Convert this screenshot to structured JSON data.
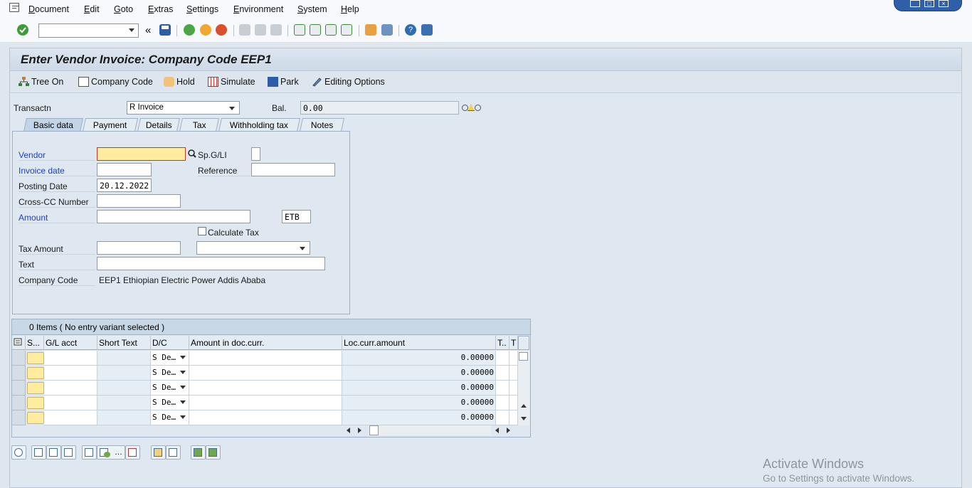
{
  "menu": [
    "Document",
    "Edit",
    "Goto",
    "Extras",
    "Settings",
    "Environment",
    "System",
    "Help"
  ],
  "toolbar": {
    "command_field_value": "",
    "back_symbol": "«"
  },
  "title": "Enter Vendor Invoice: Company Code EEP1",
  "app_toolbar": [
    "Tree On",
    "Company Code",
    "Hold",
    "Simulate",
    "Park",
    "Editing Options"
  ],
  "header": {
    "transaction_label": "Transactn",
    "transaction_value": "R Invoice",
    "balance_label": "Bal.",
    "balance_value": "0.00"
  },
  "tabs": [
    "Basic data",
    "Payment",
    "Details",
    "Tax",
    "Withholding tax",
    "Notes"
  ],
  "active_tab": "Basic data",
  "form": {
    "vendor_label": "Vendor",
    "vendor_value": "",
    "spgl_label": "Sp.G/LI",
    "invoice_date_label": "Invoice date",
    "invoice_date_value": "",
    "reference_label": "Reference",
    "reference_value": "",
    "posting_date_label": "Posting Date",
    "posting_date_value": "20.12.2022",
    "crosscc_label": "Cross-CC Number",
    "crosscc_value": "",
    "amount_label": "Amount",
    "amount_value": "",
    "currency_value": "ETB",
    "calculate_tax_label": "Calculate Tax",
    "tax_amount_label": "Tax Amount",
    "tax_amount_value": "",
    "text_label": "Text",
    "text_value": "",
    "company_code_label": "Company Code",
    "company_code_value": "EEP1 Ethiopian Electric Power Addis Ababa"
  },
  "items": {
    "title": "0 Items ( No entry variant selected )",
    "columns": [
      "S...",
      "G/L acct",
      "Short Text",
      "D/C",
      "Amount in doc.curr.",
      "Loc.curr.amount",
      "T..",
      "T"
    ],
    "rows": [
      {
        "dc": "S De…",
        "loc_amount": "0.00000"
      },
      {
        "dc": "S De…",
        "loc_amount": "0.00000"
      },
      {
        "dc": "S De…",
        "loc_amount": "0.00000"
      },
      {
        "dc": "S De…",
        "loc_amount": "0.00000"
      },
      {
        "dc": "S De…",
        "loc_amount": "0.00000"
      }
    ]
  },
  "watermark": {
    "title": "Activate Windows",
    "subtitle": "Go to Settings to activate Windows."
  }
}
